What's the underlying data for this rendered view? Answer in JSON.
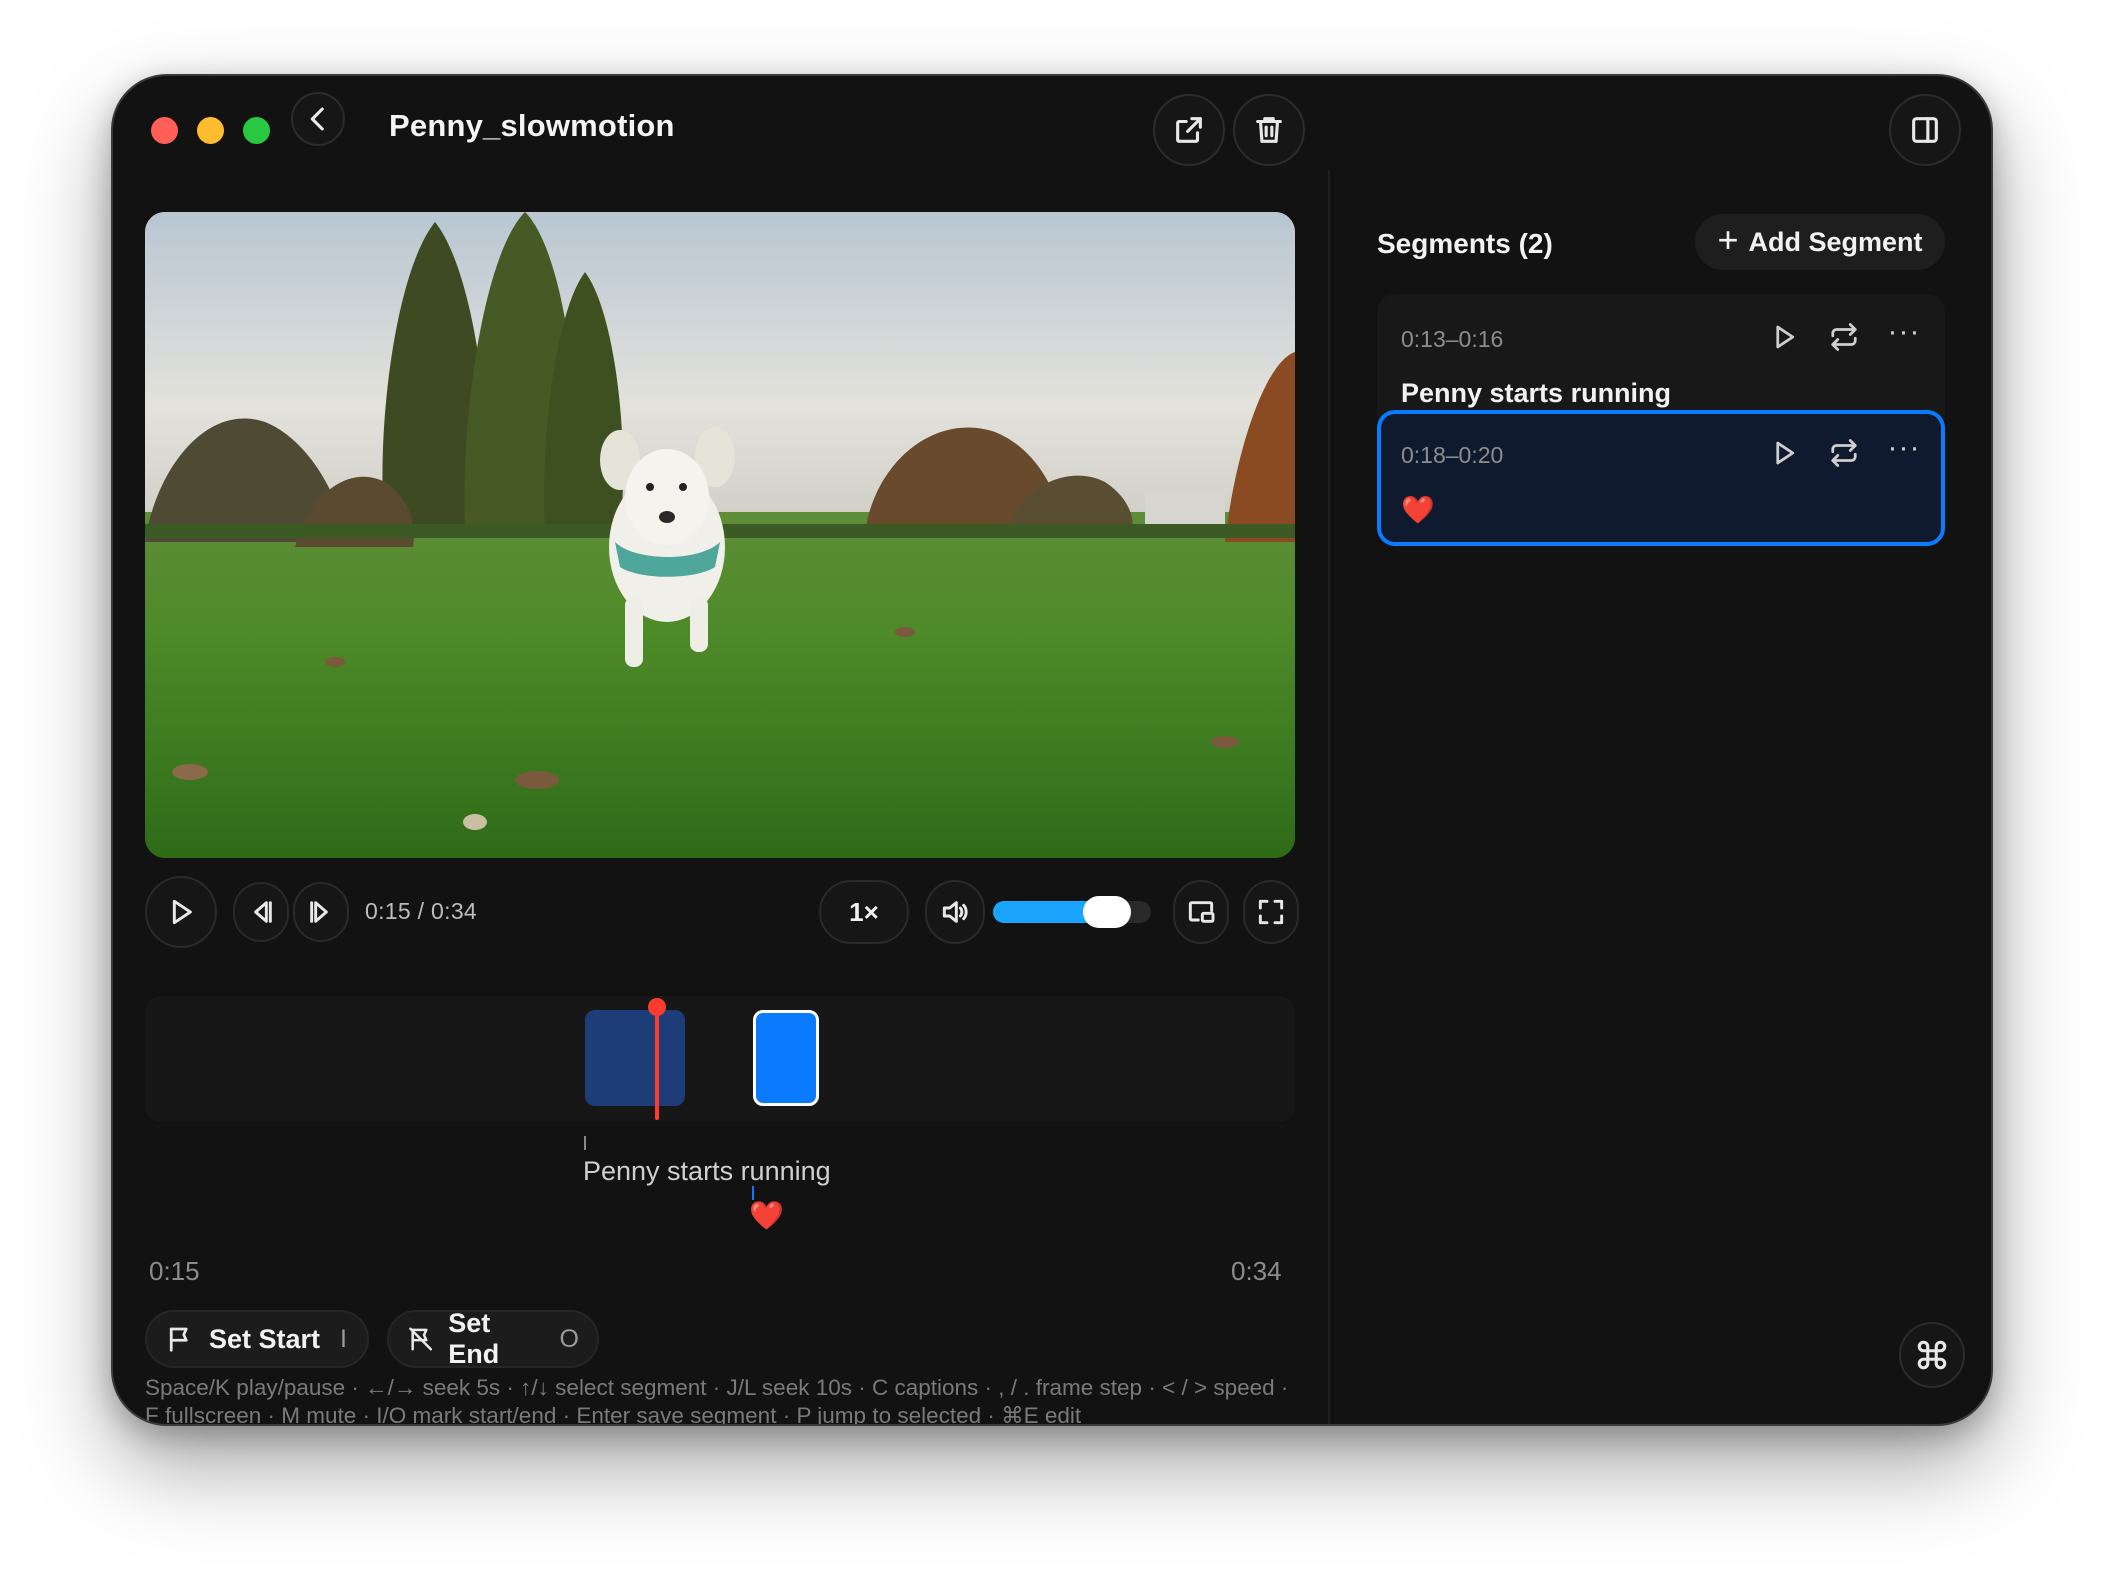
{
  "window": {
    "title": "Penny_slowmotion"
  },
  "player": {
    "time_readout": "0:15 / 0:34",
    "speed": "1×",
    "volume_level": 0.82
  },
  "timeline": {
    "playhead_time": "0:15",
    "captions": [
      {
        "text": "Penny starts running"
      },
      {
        "text": "❤️"
      }
    ],
    "range_start": "0:15",
    "range_end": "0:34"
  },
  "marks": {
    "set_start_label": "Set Start",
    "set_start_key": "I",
    "set_end_label": "Set End",
    "set_end_key": "O"
  },
  "help_text": "Space/K play/pause · ←/→ seek 5s · ↑/↓ select segment · J/L seek 10s · C captions · , / . frame step · < / > speed · F fullscreen · M mute · I/O mark start/end · Enter save segment · P jump to selected · ⌘E edit",
  "segments": {
    "header": "Segments (2)",
    "add_label": "Add Segment",
    "items": [
      {
        "range": "0:13–0:16",
        "label": "Penny starts running",
        "selected": false
      },
      {
        "range": "0:18–0:20",
        "label": "❤️",
        "selected": true
      }
    ]
  },
  "icons": {
    "back": "chevron-left-icon",
    "share": "external-link-icon",
    "delete": "trash-icon",
    "sidebar": "sidebar-toggle-icon",
    "play": "play-icon",
    "prev_frame": "step-back-icon",
    "next_frame": "step-forward-icon",
    "volume": "speaker-icon",
    "pip": "picture-in-picture-icon",
    "fullscreen": "fullscreen-icon",
    "loop": "repeat-icon",
    "more": "more-icon",
    "flag": "flag-icon",
    "flag_off": "flag-off-icon",
    "command": "command-icon"
  },
  "colors": {
    "accent": "#0a7bff",
    "playhead": "#ff3b30",
    "volume": "#1aa3ff",
    "selected_segment_bg": "#0f1a2e"
  }
}
